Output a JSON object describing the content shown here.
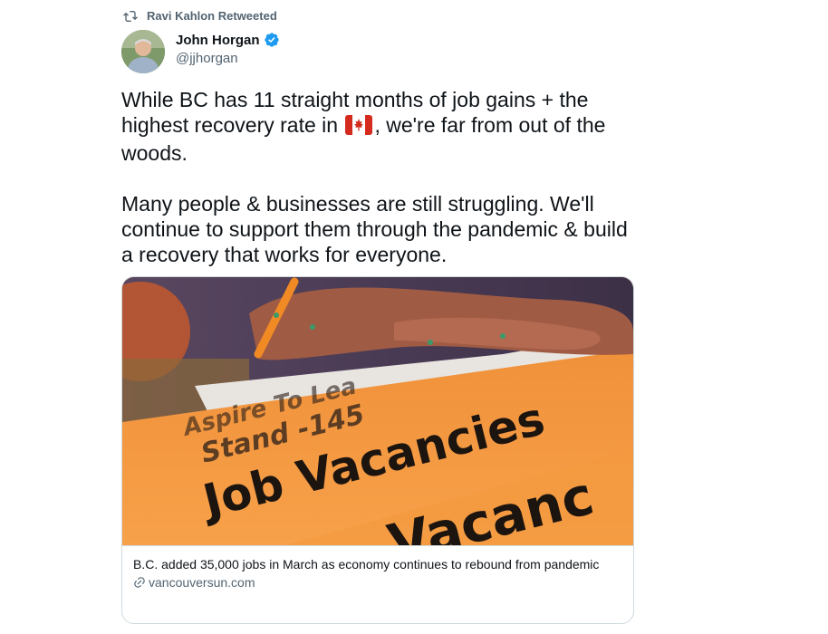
{
  "retweet": {
    "icon": "retweet-icon",
    "text": "Ravi Kahlon Retweeted"
  },
  "author": {
    "name": "John Horgan",
    "handle": "@jjhorgan",
    "verified": true,
    "verified_color": "#1d9bf0"
  },
  "tweet": {
    "paragraph1_part1": "While BC has 11 straight months of job gains + the highest recovery rate in",
    "flag_icon": "canada-flag-icon",
    "paragraph1_part2": ", we're far from out of the woods.",
    "paragraph2": "Many people & businesses are still struggling. We'll continue to support them through the pandemic & build a recovery that works for everyone."
  },
  "card": {
    "image_text": {
      "line1": "Aspire To Lea",
      "line2": "Stand -145",
      "line3": "Job Vacancies",
      "line4": "Vacanc"
    },
    "title": "B.C. added 35,000 jobs in March as economy continues to rebound from pandemic",
    "domain": "vancouversun.com",
    "link_icon": "link-icon"
  }
}
